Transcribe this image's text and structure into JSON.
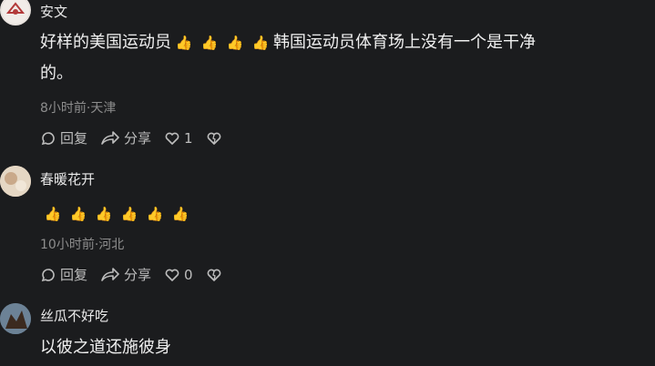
{
  "comments": [
    {
      "username": "安文",
      "text_before": "好样的美国运动员",
      "thumbs_inline": [
        "👍",
        "👍",
        "👍",
        "👍"
      ],
      "text_after": "韩国运动员体育场上没有一个是干净",
      "text_line2": "的。",
      "meta": "8小时前·天津",
      "reply_label": "回复",
      "share_label": "分享",
      "like_count": "1"
    },
    {
      "username": "春暖花开",
      "thumbs": [
        "👍",
        "👍",
        "👍",
        "👍",
        "👍",
        "👍"
      ],
      "meta": "10小时前·河北",
      "reply_label": "回复",
      "share_label": "分享",
      "like_count": "0"
    },
    {
      "username": "丝瓜不好吃",
      "text": "以彼之道还施彼身"
    }
  ],
  "colors": {
    "background": "#1b1c1e",
    "meta": "#8d8d8d",
    "thumb": "#f2b632"
  },
  "icons": [
    "reply-icon",
    "share-icon",
    "like-icon",
    "dislike-icon",
    "thumbs-up-emoji"
  ]
}
